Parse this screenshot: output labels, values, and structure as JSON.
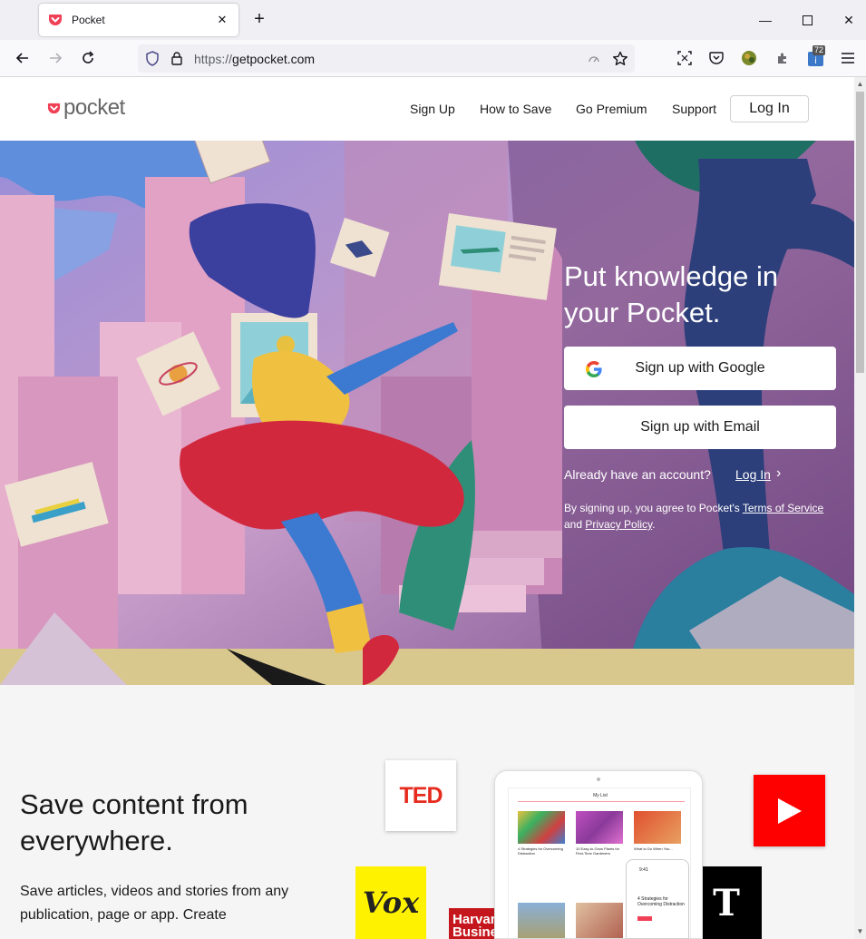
{
  "browser": {
    "tab_title": "Pocket",
    "url_scheme": "https://",
    "url_host": "getpocket.com",
    "extension_badge": "72"
  },
  "header": {
    "logo_text": "pocket",
    "nav": [
      "Sign Up",
      "How to Save",
      "Go Premium",
      "Support"
    ],
    "login_label": "Log In"
  },
  "hero": {
    "title": "Put knowledge in your Pocket.",
    "google_button": "Sign up with Google",
    "email_button": "Sign up with Email",
    "already_text": "Already have an account?",
    "login_link": "Log In",
    "legal_prefix": "By signing up, you agree to Pocket's",
    "terms_link": "Terms of Service",
    "legal_and": "and",
    "privacy_link": "Privacy Policy",
    "legal_suffix": "."
  },
  "section2": {
    "title": "Save content from everywhere.",
    "body": "Save articles, videos and stories from any publication, page or app. Create",
    "logos": {
      "ted": "TED",
      "vox": "Vox",
      "hbr": "Harvard Business"
    },
    "phone": {
      "title": "My List",
      "time": "9:41",
      "cards": [
        "4 Strategies for Overcoming Distraction",
        "10 Easy-to-Grow Plants for First-Time Gardeners",
        "What to Do When You..."
      ],
      "small_card": "4 Strategies for Overcoming Distraction"
    }
  },
  "colors": {
    "pocket_red": "#ef4056",
    "youtube_red": "#ff0000",
    "vox_yellow": "#fff200"
  }
}
